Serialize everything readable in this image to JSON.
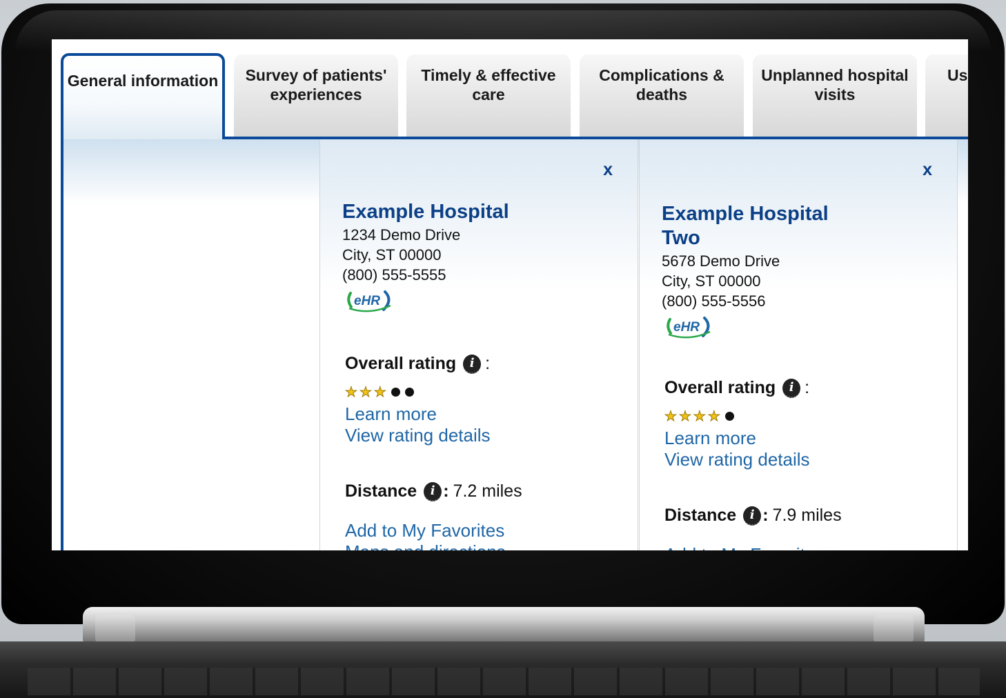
{
  "tabs": [
    {
      "label": "General information",
      "active": true
    },
    {
      "label": "Survey of patients' experiences",
      "active": false
    },
    {
      "label": "Timely & effective care",
      "active": false
    },
    {
      "label": "Complications & deaths",
      "active": false
    },
    {
      "label": "Unplanned hospital visits",
      "active": false
    },
    {
      "label": "Us",
      "active": false
    }
  ],
  "hospitals": [
    {
      "close_label": "x",
      "name": "Example Hospital",
      "address_line1": "1234 Demo Drive",
      "address_line2": "City, ST 00000",
      "phone": "(800) 555-5555",
      "logo_icon": "ehr-logo-icon",
      "overall_rating_label": "Overall rating",
      "rating_stars": 3,
      "rating_max": 5,
      "learn_more": "Learn more",
      "view_rating_details": "View rating details",
      "distance_label": "Distance",
      "distance_value": "7.2 miles",
      "add_favorites": "Add to My Favorites",
      "maps_directions": "Maps and directions"
    },
    {
      "close_label": "x",
      "name": "Example Hospital Two",
      "address_line1": "5678 Demo Drive",
      "address_line2": "City, ST 00000",
      "phone": "(800) 555-5556",
      "logo_icon": "ehr-logo-icon",
      "overall_rating_label": "Overall rating",
      "rating_stars": 4,
      "rating_max": 5,
      "learn_more": "Learn more",
      "view_rating_details": "View rating details",
      "distance_label": "Distance",
      "distance_value": "7.9 miles",
      "add_favorites": "Add to My Favorites"
    }
  ],
  "colors": {
    "accent": "#0b4a99",
    "link": "#1f66a6",
    "star": "#f0c419"
  }
}
